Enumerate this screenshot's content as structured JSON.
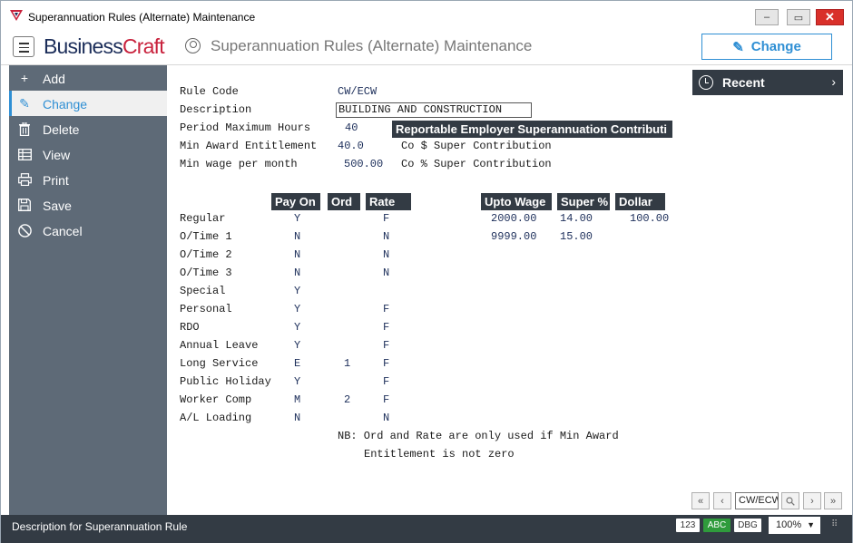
{
  "window": {
    "title": "Superannuation Rules (Alternate) Maintenance",
    "controls": {
      "minimize": "–",
      "maximize": "▭",
      "close": "✕"
    }
  },
  "header": {
    "brand_part1": "Business",
    "brand_part2": "Craft",
    "page_title": "Superannuation Rules (Alternate) Maintenance",
    "change_button": "Change"
  },
  "sidebar": {
    "items": [
      {
        "label": "Add",
        "icon": "plus-icon",
        "glyph": "+"
      },
      {
        "label": "Change",
        "icon": "edit-icon",
        "glyph": "✎"
      },
      {
        "label": "Delete",
        "icon": "trash-icon",
        "glyph": "🗑"
      },
      {
        "label": "View",
        "icon": "table-icon",
        "glyph": "▦"
      },
      {
        "label": "Print",
        "icon": "printer-icon",
        "glyph": "⎙"
      },
      {
        "label": "Save",
        "icon": "save-icon",
        "glyph": "💾"
      },
      {
        "label": "Cancel",
        "icon": "cancel-icon",
        "glyph": "⊘"
      }
    ],
    "active_index": 1
  },
  "form": {
    "rule_code_label": "Rule Code",
    "rule_code_value": "CW/ECW",
    "description_label": "Description",
    "description_value": "BUILDING AND CONSTRUCTION",
    "period_max_hours_label": "Period Maximum Hours",
    "period_max_hours_value": "40",
    "min_award_label": "Min Award Entitlement",
    "min_award_value": "40.0",
    "min_wage_label": "Min wage per month",
    "min_wage_value": "500.00",
    "reportable_header": "Reportable Employer Superannuation Contributi",
    "co_dollar_label": "Co $ Super Contribution",
    "co_pct_label": "Co % Super Contribution"
  },
  "rates_table": {
    "headers": {
      "pay_on": "Pay On",
      "ord": "Ord",
      "rate": "Rate",
      "upto_wage": "Upto Wage",
      "super_pct": "Super %",
      "dollar": "Dollar"
    },
    "rows": [
      {
        "label": "Regular",
        "pay_on": "Y",
        "ord": "",
        "rate": "F"
      },
      {
        "label": "O/Time 1",
        "pay_on": "N",
        "ord": "",
        "rate": "N"
      },
      {
        "label": "O/Time 2",
        "pay_on": "N",
        "ord": "",
        "rate": "N"
      },
      {
        "label": "O/Time 3",
        "pay_on": "N",
        "ord": "",
        "rate": "N"
      },
      {
        "label": "Special",
        "pay_on": "Y",
        "ord": "",
        "rate": ""
      },
      {
        "label": "Personal",
        "pay_on": "Y",
        "ord": "",
        "rate": "F"
      },
      {
        "label": "RDO",
        "pay_on": "Y",
        "ord": "",
        "rate": "F"
      },
      {
        "label": "Annual Leave",
        "pay_on": "Y",
        "ord": "",
        "rate": "F"
      },
      {
        "label": "Long Service",
        "pay_on": "E",
        "ord": "1",
        "rate": "F"
      },
      {
        "label": "Public Holiday",
        "pay_on": "Y",
        "ord": "",
        "rate": "F"
      },
      {
        "label": "Worker Comp",
        "pay_on": "M",
        "ord": "2",
        "rate": "F"
      },
      {
        "label": "A/L Loading",
        "pay_on": "N",
        "ord": "",
        "rate": "N"
      }
    ],
    "tiers": [
      {
        "upto_wage": "2000.00",
        "super_pct": "14.00",
        "dollar": "100.00"
      },
      {
        "upto_wage": "9999.00",
        "super_pct": "15.00",
        "dollar": ""
      }
    ]
  },
  "note": {
    "line1": "NB: Ord and Rate are only used if Min Award",
    "line2": "Entitlement is not zero"
  },
  "recent": {
    "label": "Recent"
  },
  "navigator": {
    "current": "CW/ECW"
  },
  "statusbar": {
    "text": "Description for Superannuation Rule",
    "pill_123": "123",
    "pill_abc": "ABC",
    "pill_dbg": "DBG",
    "zoom": "100%"
  }
}
